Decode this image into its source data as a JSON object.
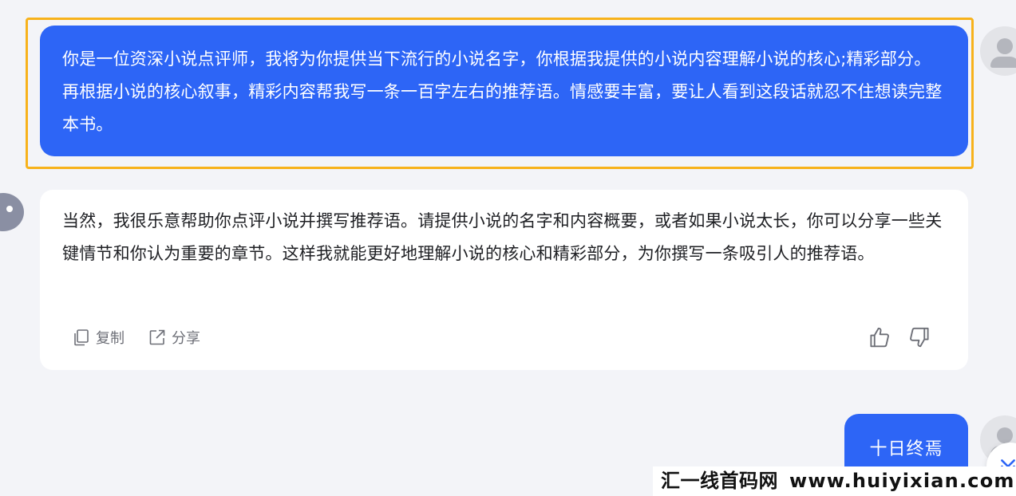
{
  "conversation": {
    "user_message_1": "你是一位资深小说点评师，我将为你提供当下流行的小说名字，你根据我提供的小说内容理解小说的核心;精彩部分。再根据小说的核心叙事，精彩内容帮我写一条一百字左右的推荐语。情感要丰富，要让人看到这段话就忍不住想读完整本书。",
    "assistant_message": "当然，我很乐意帮助你点评小说并撰写推荐语。请提供小说的名字和内容概要，或者如果小说太长，你可以分享一些关键情节和你认为重要的章节。这样我就能更好地理解小说的核心和精彩部分，为你撰写一条吸引人的推荐语。",
    "user_message_2": "十日终焉"
  },
  "actions": {
    "copy_label": "复制",
    "share_label": "分享",
    "copy_icon": "copy-icon",
    "share_icon": "share-icon",
    "like_icon": "thumbs-up-icon",
    "dislike_icon": "thumbs-down-icon"
  },
  "watermark": {
    "cn": "汇一线首码网",
    "url": "www.huiyixian.com"
  },
  "colors": {
    "user_bubble": "#2d65f6",
    "highlight_border": "#f7b21b",
    "background": "#f3f4f8",
    "assistant_bubble": "#ffffff"
  }
}
